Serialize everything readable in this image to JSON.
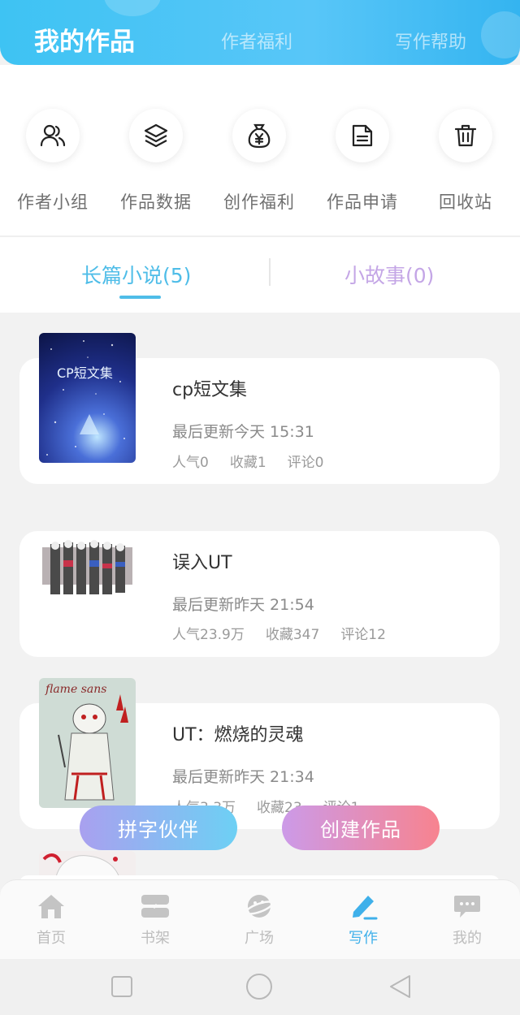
{
  "header": {
    "tabs": [
      {
        "label": "我的作品",
        "active": true
      },
      {
        "label": "作者福利",
        "active": false
      },
      {
        "label": "写作帮助",
        "active": false
      }
    ]
  },
  "tools": [
    {
      "label": "作者小组",
      "icon": "users-icon"
    },
    {
      "label": "作品数据",
      "icon": "layers-icon"
    },
    {
      "label": "创作福利",
      "icon": "money-bag-icon"
    },
    {
      "label": "作品申请",
      "icon": "document-icon"
    },
    {
      "label": "回收站",
      "icon": "trash-icon"
    }
  ],
  "segments": {
    "novel": "长篇小说(5)",
    "story": "小故事(0)"
  },
  "works": [
    {
      "title": "cp短文集",
      "cover_text": "CP短文集",
      "updated": "最后更新今天 15:31",
      "popularity": "人气0",
      "favorites": "收藏1",
      "comments": "评论0"
    },
    {
      "title": "误入UT",
      "updated": "最后更新昨天 21:54",
      "popularity": "人气23.9万",
      "favorites": "收藏347",
      "comments": "评论12"
    },
    {
      "title": "UT：燃烧的灵魂",
      "cover_text": "flame sans",
      "updated": "最后更新昨天 21:34",
      "popularity": "人气3.3万",
      "favorites": "收藏23",
      "comments": "评论1"
    }
  ],
  "fabs": {
    "partner": "拼字伙伴",
    "create": "创建作品"
  },
  "tabbar": [
    {
      "label": "首页",
      "icon": "home-icon"
    },
    {
      "label": "书架",
      "icon": "bookshelf-icon"
    },
    {
      "label": "广场",
      "icon": "planet-icon"
    },
    {
      "label": "写作",
      "icon": "pen-icon",
      "active": true
    },
    {
      "label": "我的",
      "icon": "chat-bubble-icon"
    }
  ],
  "colors": {
    "accent": "#4fbde8",
    "header_gradient": [
      "#3ec3f3",
      "#34b4f0"
    ],
    "fab_partner": [
      "#a9a0ef",
      "#6dd0f4"
    ],
    "fab_create": [
      "#cc9ae8",
      "#f7838f"
    ]
  }
}
